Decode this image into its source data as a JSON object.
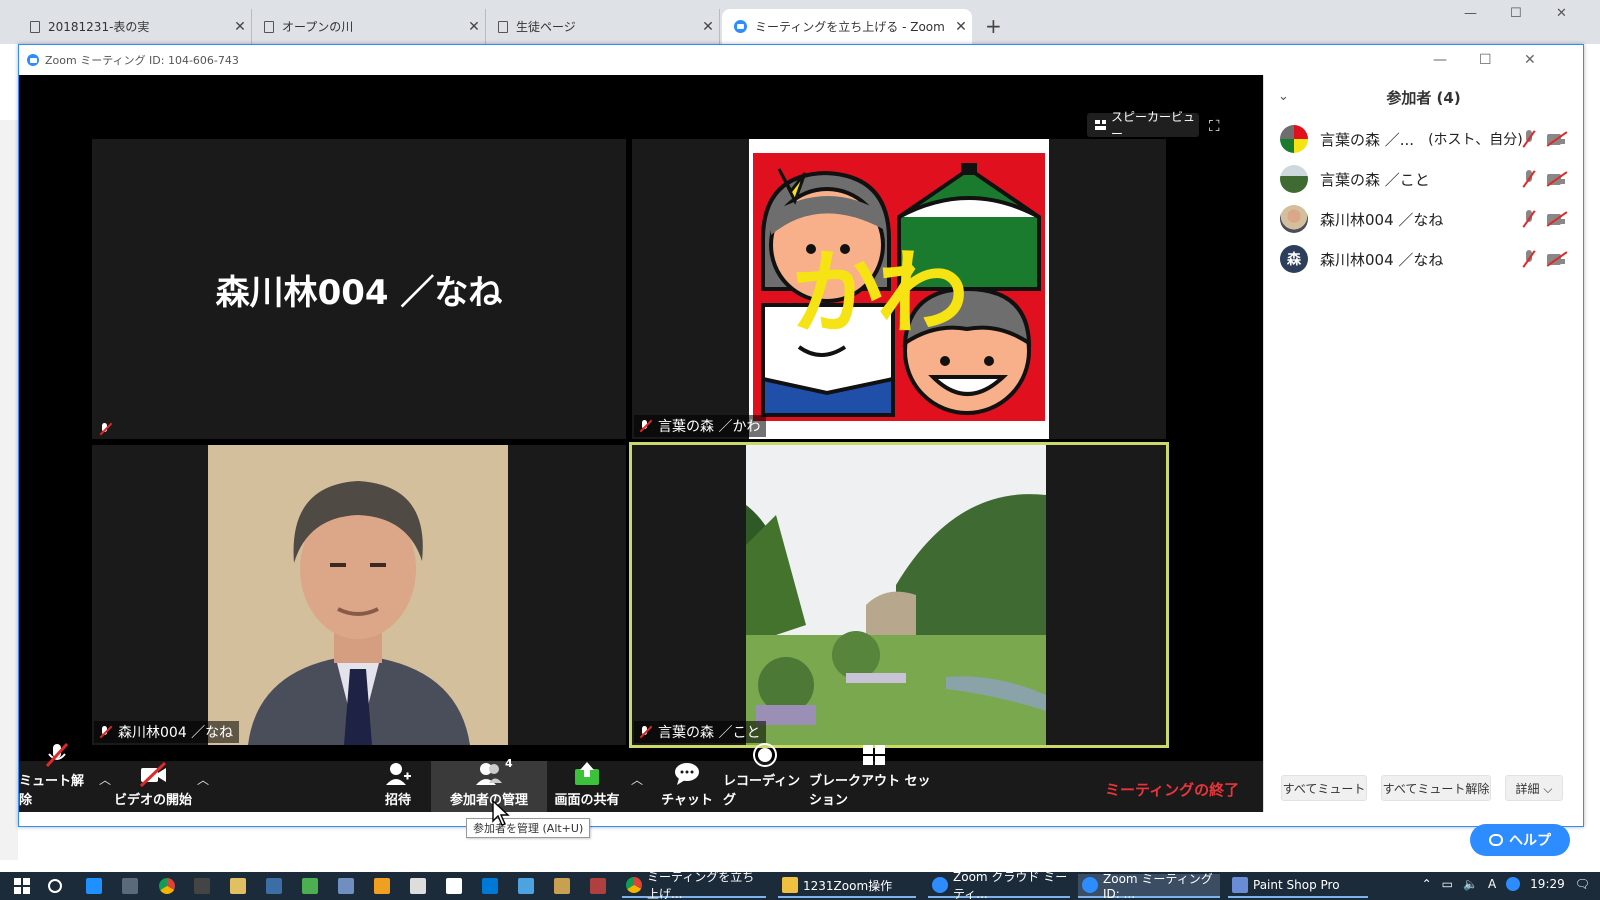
{
  "browser": {
    "tabs": [
      {
        "title": "20181231-表の実",
        "icon": "document-icon"
      },
      {
        "title": "オープンの川",
        "icon": "document-icon"
      },
      {
        "title": "生徒ページ",
        "icon": "document-icon"
      },
      {
        "title": "ミーティングを立ち上げる - Zoom",
        "icon": "zoom-icon"
      }
    ],
    "close_glyph": "✕",
    "new_tab_glyph": "+"
  },
  "zoom_window": {
    "title": "Zoom ミーティング ID: 104-606-743",
    "speaker_view_label": "スピーカービュー"
  },
  "tiles": [
    {
      "big_name": "森川林004 ／なね",
      "label": ""
    },
    {
      "label": "言葉の森 ／かわ",
      "overlay_text": "かわ"
    },
    {
      "label": "森川林004 ／なね"
    },
    {
      "label": "言葉の森 ／こと"
    }
  ],
  "toolbar": {
    "mute": "ミュート解除",
    "video": "ビデオの開始",
    "invite": "招待",
    "participants": "参加者の管理",
    "participants_count": "4",
    "share": "画面の共有",
    "chat": "チャット",
    "record": "レコーディング",
    "breakout": "ブレークアウト セッション",
    "end": "ミーティングの終了",
    "tooltip": "参加者を管理 (Alt+U)"
  },
  "panel": {
    "title": "参加者 (4)",
    "participants": [
      {
        "name": "言葉の森 ／...",
        "role": "(ホスト、自分)"
      },
      {
        "name": "言葉の森 ／こと",
        "role": ""
      },
      {
        "name": "森川林004 ／なね",
        "role": ""
      },
      {
        "name": "森川林004 ／なね",
        "role": "",
        "avatar_text": "森"
      }
    ],
    "mute_all": "すべてミュート",
    "unmute_all": "すべてミュート解除",
    "more": "詳細 ⌵"
  },
  "help_label": "ヘルプ",
  "taskbar": {
    "apps": [
      {
        "label": "ミーティングを立ち上げ..."
      },
      {
        "label": "1231Zoom操作"
      },
      {
        "label": "Zoom クラウド ミーティ..."
      },
      {
        "label": "Zoom ミーティング ID: ..."
      },
      {
        "label": "Paint Shop Pro"
      }
    ],
    "tray_ime": "A",
    "clock": "19:29"
  },
  "colors": {
    "zoom_blue": "#2d8cff",
    "end_red": "#e8353a",
    "active_speaker_border": "#cbd96a",
    "share_green": "#3cc13b"
  }
}
